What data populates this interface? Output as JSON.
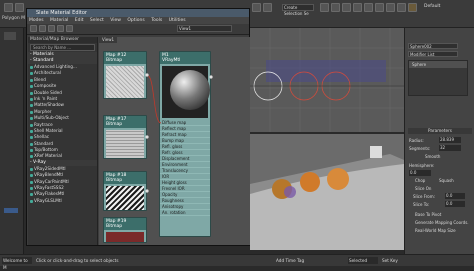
{
  "app": {
    "workspace_label": "Default",
    "selection_label": "Create Selection Se",
    "status_welcome": "Welcome to M",
    "status_hint": "Click or click-and-drag to select objects",
    "status_add_time_tag": "Add Time Tag",
    "status_selected": "Selected",
    "status_set_key": "Set Key",
    "left_label": "Polygon M"
  },
  "material_editor": {
    "title": "Slate Material Editor",
    "menu": [
      "Modes",
      "Material",
      "Edit",
      "Select",
      "View",
      "Options",
      "Tools",
      "Utilities"
    ],
    "browser_title": "Material/Map Browser",
    "search_placeholder": "Search by Name ...",
    "groups": {
      "materials": "- Materials",
      "standard": "- Standard",
      "vray": "- V-Ray"
    },
    "standard_items": [
      "Advanced Lighting...",
      "Architectural",
      "Blend",
      "Composite",
      "Double Sided",
      "Ink 'n Paint",
      "Matte/Shadow",
      "Morpher",
      "Multi/Sub-Object",
      "Raytrace",
      "Shell Material",
      "Shellac",
      "Standard",
      "Top/Bottom",
      "XRef Material"
    ],
    "vray_items": [
      "VRay2SidedMtl",
      "VRayBlendMtl",
      "VRayCarPaintMtl",
      "VRayFastSSS2",
      "VRayFlakesMtl",
      "VRayGLSLMtl"
    ],
    "view_tab": "View1",
    "nodes": {
      "map1": {
        "id": "Map #12",
        "type": "Bitmap"
      },
      "m1": {
        "id": "M1",
        "type": "VRayMtl"
      },
      "map2": {
        "id": "Map #17",
        "type": "Bitmap"
      },
      "map3": {
        "id": "Map #18",
        "type": "Bitmap"
      },
      "map4": {
        "id": "Map #19",
        "type": "Bitmap"
      }
    },
    "slots": [
      "Diffuse map",
      "Reflect map",
      "Refract map",
      "Bump map",
      "Refl. gloss",
      "Refr. gloss",
      "Displacement",
      "Environment",
      "Translucency",
      "IOR",
      "Height gloss",
      "Fresnel IOR",
      "Opacity",
      "Roughness",
      "Anisotropy",
      "An. rotation"
    ]
  },
  "viewport_top": {
    "label": ""
  },
  "viewport_persp": {
    "label": ""
  },
  "command_panel": {
    "object_name": "Sphere002",
    "modifier_list": "Modifier List",
    "stack_item": "Sphere",
    "rollout": "Parameters",
    "radius_label": "Radius:",
    "radius_value": "28.839",
    "segments_label": "Segments:",
    "segments_value": "32",
    "smooth_label": "Smooth",
    "hemisphere_label": "Hemisphere:",
    "hemisphere_value": "0.0",
    "chop_label": "Chop",
    "squash_label": "Squash",
    "slice_on_label": "Slice On",
    "slice_from_label": "Slice From:",
    "slice_from_value": "0.0",
    "slice_to_label": "Slice To:",
    "slice_to_value": "0.0",
    "base_to_pivot": "Base To Pivot",
    "gen_mapping": "Generate Mapping Coords.",
    "real_world": "Real-World Map Size"
  },
  "colors": {
    "node_body": "#7fa8a6",
    "node_head": "#3c6e6a",
    "sphere_orange": "#d07a2a",
    "wire_red": "#c0392b"
  }
}
